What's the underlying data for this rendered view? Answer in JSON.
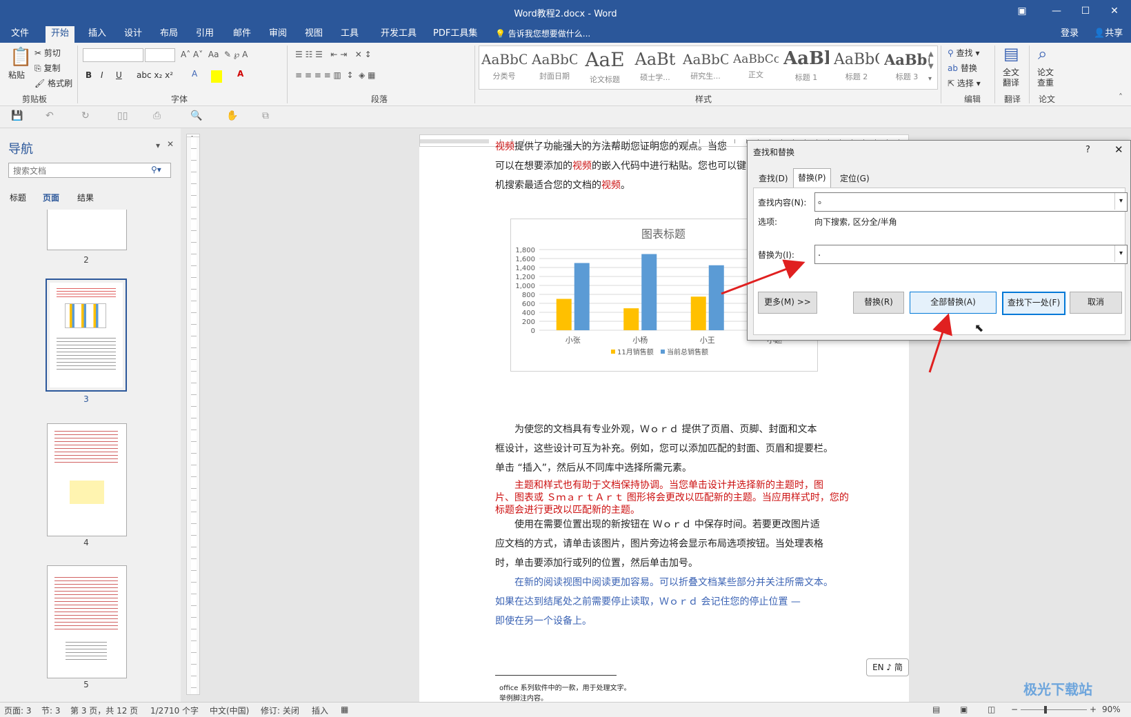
{
  "window": {
    "title": "Word教程2.docx - Word"
  },
  "tabs": [
    "文件",
    "开始",
    "插入",
    "设计",
    "布局",
    "引用",
    "邮件",
    "审阅",
    "视图",
    "工具",
    "开发工具",
    "PDF工具集"
  ],
  "tell_me": "告诉我您想要做什么...",
  "account": {
    "login": "登录",
    "share": "共享"
  },
  "ribbon": {
    "clipboard": {
      "paste": "粘贴",
      "cut": "剪切",
      "copy": "复制",
      "format_painter": "格式刷",
      "label": "剪贴板"
    },
    "font": {
      "label": "字体"
    },
    "paragraph": {
      "label": "段落"
    },
    "styles": {
      "label": "样式",
      "items": [
        {
          "preview": "AaBbCc",
          "name": "分类号"
        },
        {
          "preview": "AaBbCc",
          "name": "封面日期"
        },
        {
          "preview": "AaE",
          "name": "论文标题"
        },
        {
          "preview": "AaBt",
          "name": "硕士学..."
        },
        {
          "preview": "AaBbCc",
          "name": "研究生..."
        },
        {
          "preview": "AaBbCcI",
          "name": "正文"
        },
        {
          "preview": "AaBl",
          "name": "标题 1"
        },
        {
          "preview": "AaBbC",
          "name": "标题 2"
        },
        {
          "preview": "AaBb(",
          "name": "标题 3"
        }
      ]
    },
    "editing": {
      "find": "查找",
      "replace": "替换",
      "select": "选择",
      "label": "编辑"
    },
    "translate": {
      "button": "全文\n翻译",
      "label": "翻译"
    },
    "paper": {
      "button": "论文\n查重",
      "label": "论文"
    }
  },
  "nav": {
    "title": "导航",
    "search_placeholder": "搜索文档",
    "tabs": [
      "标题",
      "页面",
      "结果"
    ],
    "pages": [
      "2",
      "3",
      "4",
      "5"
    ]
  },
  "document": {
    "line1_red": "视频",
    "line1_rest": "提供了功能强大的方法帮助您证明您的观点。当您",
    "line2a": "可以在想要添加的",
    "line2_red": "视频",
    "line2b": "的嵌入代码中进行粘贴。您也可以键",
    "line3a": "机搜索最适合您的文档的",
    "line3_red": "视频",
    "line3b": "。",
    "para2_l1": "为使您的文档具有专业外观，Ｗｏｒｄ 提供了页眉、页脚、封面和文本",
    "para2_l2": "框设计，这些设计可互为补充。例如，您可以添加匹配的封面、页眉和提要栏。",
    "para2_l3": "单击 “插入”，然后从不同库中选择所需元素。",
    "para3_l1": "主题和样式也有助于文档保持协调。当您单击设计并选择新的主题时，图",
    "para3_l2": "片、图表或 ＳｍａｒｔＡｒｔ 图形将会更改以匹配新的主题。当应用样式时，您的",
    "para3_l3": "标题会进行更改以匹配新的主题。",
    "para4_l1": "使用在需要位置出现的新按钮在 Ｗｏｒｄ 中保存时间。若要更改图片适",
    "para4_l2": "应文档的方式，请单击该图片，图片旁边将会显示布局选项按钮。当处理表格",
    "para4_l3": "时，单击要添加行或列的位置，然后单击加号。",
    "para5_l1": "在新的阅读视图中阅读更加容易。可以折叠文档某些部分并关注所需文本。",
    "para5_l2": "如果在达到结尾处之前需要停止读取，Ｗｏｒｄ 会记住您的停止位置 —",
    "para5_l3": "即使在另一个设备上。",
    "footnote1": "office 系列软件中的一款，用于处理文字。",
    "footnote2": "举例脚注内容。",
    "ime": "EN ♪ 简"
  },
  "chart_data": {
    "type": "bar",
    "title": "图表标题",
    "categories": [
      "小张",
      "小杨",
      "小王",
      "小赵"
    ],
    "series": [
      {
        "name": "11月销售额",
        "values": [
          700,
          490,
          750,
          0
        ],
        "color": "#ffc000"
      },
      {
        "name": "当前总销售额",
        "values": [
          1500,
          1700,
          1450,
          0
        ],
        "color": "#5b9bd5"
      }
    ],
    "ylim": [
      0,
      1800
    ],
    "yticks": [
      "1,800",
      "1,600",
      "1,400",
      "1,200",
      "1,000",
      "800",
      "600",
      "400",
      "200",
      "0"
    ],
    "grid": true,
    "legend": "bottom"
  },
  "dialog": {
    "title": "查找和替换",
    "help": "?",
    "close": "✕",
    "tabs": [
      "查找(D)",
      "替换(P)",
      "定位(G)"
    ],
    "find_label": "查找内容(N):",
    "find_value": "。",
    "options_label": "选项:",
    "options_value": "向下搜索, 区分全/半角",
    "replace_label": "替换为(I):",
    "replace_value": ".",
    "buttons": {
      "more": "更多(M) >>",
      "replace": "替换(R)",
      "replace_all": "全部替换(A)",
      "find_next": "查找下一处(F)",
      "cancel": "取消"
    }
  },
  "status": {
    "page": "页面: 3",
    "section": "节: 3",
    "page_of": "第 3 页，共 12 页",
    "words": "1/2710 个字",
    "lang": "中文(中国)",
    "track": "修订: 关闭",
    "insert": "插入",
    "zoom": "90%"
  },
  "watermark": "极光下载站"
}
